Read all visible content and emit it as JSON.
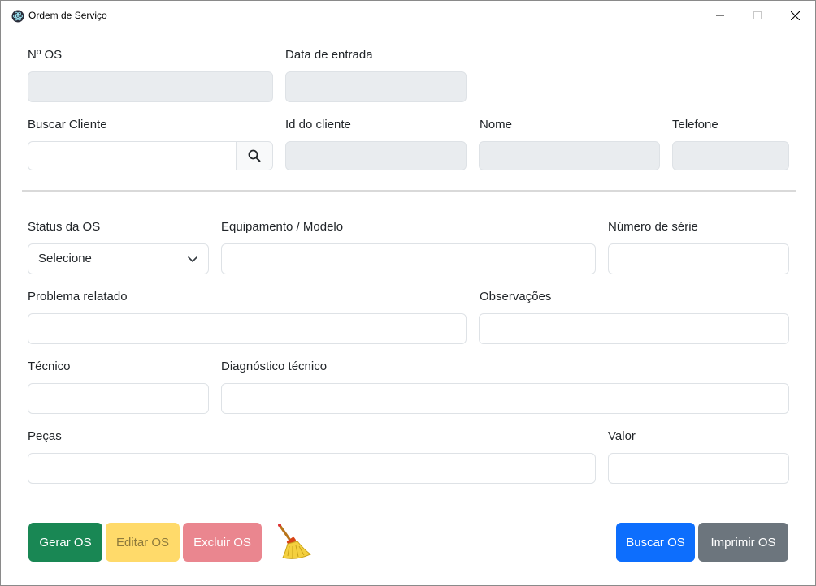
{
  "window": {
    "title": "Ordem de Serviço",
    "icon": "app-logo-icon"
  },
  "header": {
    "os_number_label": "Nº OS",
    "os_number_value": "",
    "entry_date_label": "Data de entrada",
    "entry_date_value": ""
  },
  "client": {
    "search_label": "Buscar Cliente",
    "search_value": "",
    "search_icon": "search-icon",
    "id_label": "Id do cliente",
    "id_value": "",
    "name_label": "Nome",
    "name_value": "",
    "phone_label": "Telefone",
    "phone_value": ""
  },
  "form": {
    "status_label": "Status da OS",
    "status_selected": "Selecione",
    "equipment_label": "Equipamento / Modelo",
    "equipment_value": "",
    "serial_label": "Número de série",
    "serial_value": "",
    "problem_label": "Problema relatado",
    "problem_value": "",
    "notes_label": "Observações",
    "notes_value": "",
    "technician_label": "Técnico",
    "technician_value": "",
    "diagnosis_label": "Diagnóstico técnico",
    "diagnosis_value": "",
    "parts_label": "Peças",
    "parts_value": "",
    "value_label": "Valor",
    "value_value": ""
  },
  "actions": {
    "generate": "Gerar OS",
    "edit": "Editar OS",
    "delete": "Excluir OS",
    "clear_icon": "broom-icon",
    "search": "Buscar OS",
    "print": "Imprimir OS"
  },
  "colors": {
    "generate": "#198754",
    "edit": "#ffda6a",
    "delete": "#ea868f",
    "search": "#0d6efd",
    "print": "#6c757d",
    "readonly_field": "#e9ecef"
  }
}
